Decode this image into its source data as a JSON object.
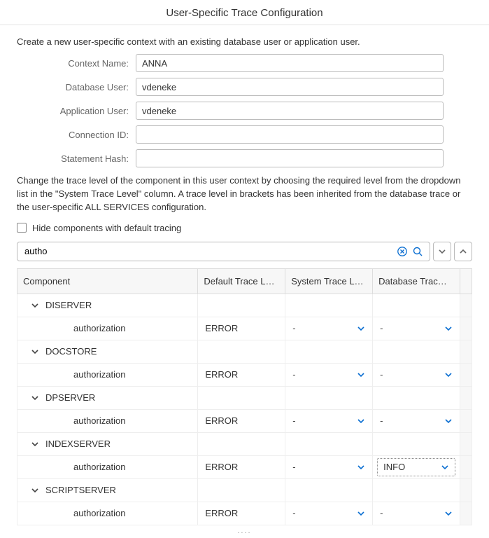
{
  "title": "User-Specific Trace Configuration",
  "intro": "Create a new user-specific context with an existing database user or application user.",
  "form": {
    "context_name": {
      "label": "Context Name:",
      "value": "ANNA"
    },
    "db_user": {
      "label": "Database User:",
      "value": "vdeneke"
    },
    "app_user": {
      "label": "Application User:",
      "value": "vdeneke"
    },
    "conn_id": {
      "label": "Connection ID:",
      "value": ""
    },
    "stmt_hash": {
      "label": "Statement Hash:",
      "value": ""
    }
  },
  "desc": "Change the trace level of the component in this user context by choosing the required level from the dropdown list in the \"System Trace Level\" column. A trace level in brackets has been inherited from the database trace or the user-specific ALL SERVICES configuration.",
  "hide_checkbox_label": "Hide components with default tracing",
  "search": {
    "value": "autho"
  },
  "columns": {
    "component": "Component",
    "default_trace": "Default Trace L…",
    "system_trace": "System Trace L…",
    "db_trace": "Database Trac…"
  },
  "groups": [
    {
      "name": "DISERVER",
      "child": "authorization",
      "default": "ERROR",
      "system": "-",
      "db": "-",
      "db_select": false
    },
    {
      "name": "DOCSTORE",
      "child": "authorization",
      "default": "ERROR",
      "system": "-",
      "db": "-",
      "db_select": false
    },
    {
      "name": "DPSERVER",
      "child": "authorization",
      "default": "ERROR",
      "system": "-",
      "db": "-",
      "db_select": false
    },
    {
      "name": "INDEXSERVER",
      "child": "authorization",
      "default": "ERROR",
      "system": "-",
      "db": "INFO",
      "db_select": true
    },
    {
      "name": "SCRIPTSERVER",
      "child": "authorization",
      "default": "ERROR",
      "system": "-",
      "db": "-",
      "db_select": false
    }
  ],
  "resizer": "...."
}
